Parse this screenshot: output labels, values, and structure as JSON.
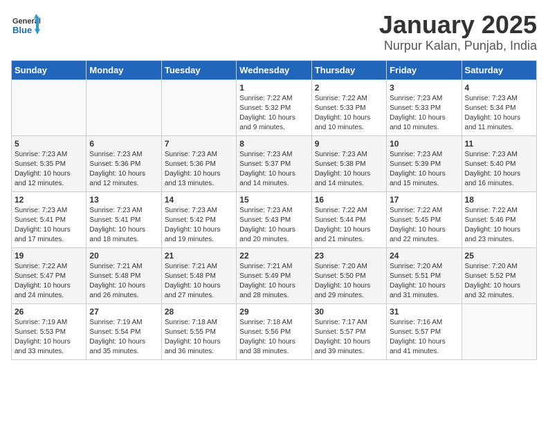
{
  "logo": {
    "line1": "General",
    "line2": "Blue"
  },
  "title": "January 2025",
  "location": "Nurpur Kalan, Punjab, India",
  "weekdays": [
    "Sunday",
    "Monday",
    "Tuesday",
    "Wednesday",
    "Thursday",
    "Friday",
    "Saturday"
  ],
  "weeks": [
    [
      {
        "day": "",
        "info": ""
      },
      {
        "day": "",
        "info": ""
      },
      {
        "day": "",
        "info": ""
      },
      {
        "day": "1",
        "info": "Sunrise: 7:22 AM\nSunset: 5:32 PM\nDaylight: 10 hours\nand 9 minutes."
      },
      {
        "day": "2",
        "info": "Sunrise: 7:22 AM\nSunset: 5:33 PM\nDaylight: 10 hours\nand 10 minutes."
      },
      {
        "day": "3",
        "info": "Sunrise: 7:23 AM\nSunset: 5:33 PM\nDaylight: 10 hours\nand 10 minutes."
      },
      {
        "day": "4",
        "info": "Sunrise: 7:23 AM\nSunset: 5:34 PM\nDaylight: 10 hours\nand 11 minutes."
      }
    ],
    [
      {
        "day": "5",
        "info": "Sunrise: 7:23 AM\nSunset: 5:35 PM\nDaylight: 10 hours\nand 12 minutes."
      },
      {
        "day": "6",
        "info": "Sunrise: 7:23 AM\nSunset: 5:36 PM\nDaylight: 10 hours\nand 12 minutes."
      },
      {
        "day": "7",
        "info": "Sunrise: 7:23 AM\nSunset: 5:36 PM\nDaylight: 10 hours\nand 13 minutes."
      },
      {
        "day": "8",
        "info": "Sunrise: 7:23 AM\nSunset: 5:37 PM\nDaylight: 10 hours\nand 14 minutes."
      },
      {
        "day": "9",
        "info": "Sunrise: 7:23 AM\nSunset: 5:38 PM\nDaylight: 10 hours\nand 14 minutes."
      },
      {
        "day": "10",
        "info": "Sunrise: 7:23 AM\nSunset: 5:39 PM\nDaylight: 10 hours\nand 15 minutes."
      },
      {
        "day": "11",
        "info": "Sunrise: 7:23 AM\nSunset: 5:40 PM\nDaylight: 10 hours\nand 16 minutes."
      }
    ],
    [
      {
        "day": "12",
        "info": "Sunrise: 7:23 AM\nSunset: 5:41 PM\nDaylight: 10 hours\nand 17 minutes."
      },
      {
        "day": "13",
        "info": "Sunrise: 7:23 AM\nSunset: 5:41 PM\nDaylight: 10 hours\nand 18 minutes."
      },
      {
        "day": "14",
        "info": "Sunrise: 7:23 AM\nSunset: 5:42 PM\nDaylight: 10 hours\nand 19 minutes."
      },
      {
        "day": "15",
        "info": "Sunrise: 7:23 AM\nSunset: 5:43 PM\nDaylight: 10 hours\nand 20 minutes."
      },
      {
        "day": "16",
        "info": "Sunrise: 7:22 AM\nSunset: 5:44 PM\nDaylight: 10 hours\nand 21 minutes."
      },
      {
        "day": "17",
        "info": "Sunrise: 7:22 AM\nSunset: 5:45 PM\nDaylight: 10 hours\nand 22 minutes."
      },
      {
        "day": "18",
        "info": "Sunrise: 7:22 AM\nSunset: 5:46 PM\nDaylight: 10 hours\nand 23 minutes."
      }
    ],
    [
      {
        "day": "19",
        "info": "Sunrise: 7:22 AM\nSunset: 5:47 PM\nDaylight: 10 hours\nand 24 minutes."
      },
      {
        "day": "20",
        "info": "Sunrise: 7:21 AM\nSunset: 5:48 PM\nDaylight: 10 hours\nand 26 minutes."
      },
      {
        "day": "21",
        "info": "Sunrise: 7:21 AM\nSunset: 5:48 PM\nDaylight: 10 hours\nand 27 minutes."
      },
      {
        "day": "22",
        "info": "Sunrise: 7:21 AM\nSunset: 5:49 PM\nDaylight: 10 hours\nand 28 minutes."
      },
      {
        "day": "23",
        "info": "Sunrise: 7:20 AM\nSunset: 5:50 PM\nDaylight: 10 hours\nand 29 minutes."
      },
      {
        "day": "24",
        "info": "Sunrise: 7:20 AM\nSunset: 5:51 PM\nDaylight: 10 hours\nand 31 minutes."
      },
      {
        "day": "25",
        "info": "Sunrise: 7:20 AM\nSunset: 5:52 PM\nDaylight: 10 hours\nand 32 minutes."
      }
    ],
    [
      {
        "day": "26",
        "info": "Sunrise: 7:19 AM\nSunset: 5:53 PM\nDaylight: 10 hours\nand 33 minutes."
      },
      {
        "day": "27",
        "info": "Sunrise: 7:19 AM\nSunset: 5:54 PM\nDaylight: 10 hours\nand 35 minutes."
      },
      {
        "day": "28",
        "info": "Sunrise: 7:18 AM\nSunset: 5:55 PM\nDaylight: 10 hours\nand 36 minutes."
      },
      {
        "day": "29",
        "info": "Sunrise: 7:18 AM\nSunset: 5:56 PM\nDaylight: 10 hours\nand 38 minutes."
      },
      {
        "day": "30",
        "info": "Sunrise: 7:17 AM\nSunset: 5:57 PM\nDaylight: 10 hours\nand 39 minutes."
      },
      {
        "day": "31",
        "info": "Sunrise: 7:16 AM\nSunset: 5:57 PM\nDaylight: 10 hours\nand 41 minutes."
      },
      {
        "day": "",
        "info": ""
      }
    ]
  ]
}
